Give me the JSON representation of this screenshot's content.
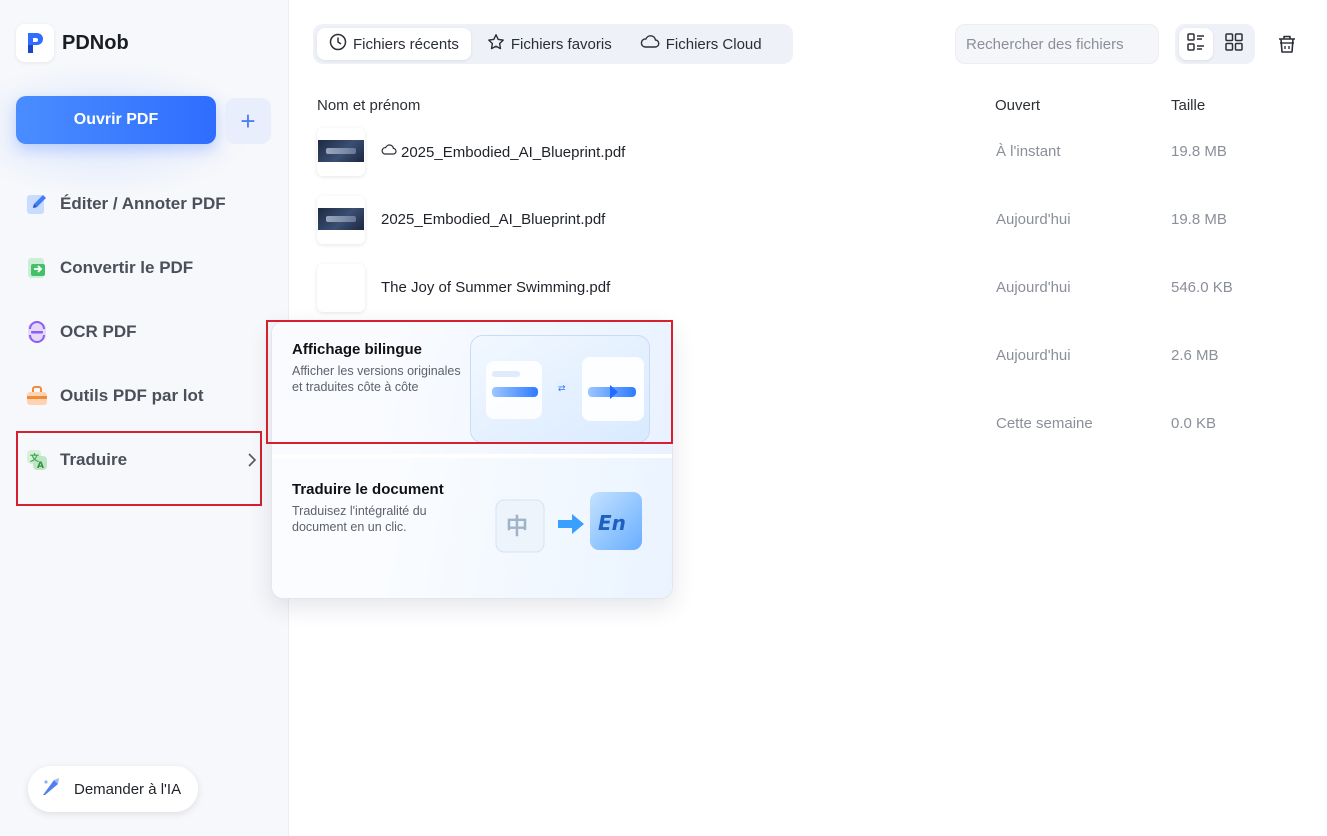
{
  "app": {
    "name": "PDNob"
  },
  "sidebar": {
    "open_button": "Ouvrir PDF",
    "add_button": "+",
    "items": [
      {
        "label": "Éditer / Annoter PDF",
        "icon": "edit-icon"
      },
      {
        "label": "Convertir le PDF",
        "icon": "convert-icon"
      },
      {
        "label": "OCR PDF",
        "icon": "ocr-icon"
      },
      {
        "label": "Outils PDF par lot",
        "icon": "batch-tools-icon"
      },
      {
        "label": "Traduire",
        "icon": "translate-icon"
      }
    ],
    "ask_ai": "Demander à l'IA"
  },
  "tabs": [
    {
      "label": "Fichiers récents",
      "icon": "clock-icon",
      "active": true
    },
    {
      "label": "Fichiers favoris",
      "icon": "star-icon",
      "active": false
    },
    {
      "label": "Fichiers Cloud",
      "icon": "cloud-icon",
      "active": false
    }
  ],
  "search": {
    "placeholder": "Rechercher des fichiers"
  },
  "columns": {
    "name": "Nom et prénom",
    "opened": "Ouvert",
    "size": "Taille"
  },
  "files": [
    {
      "name": "2025_Embodied_AI_Blueprint.pdf",
      "opened": "À l'instant",
      "size": "19.8 MB",
      "cloud": true
    },
    {
      "name": "2025_Embodied_AI_Blueprint.pdf",
      "opened": "Aujourd'hui",
      "size": "19.8 MB",
      "cloud": false
    },
    {
      "name": "The Joy of Summer Swimming.pdf",
      "opened": "Aujourd'hui",
      "size": "546.0 KB",
      "cloud": false
    },
    {
      "name": "",
      "opened": "Aujourd'hui",
      "size": "2.6 MB",
      "cloud": false
    },
    {
      "name": "",
      "opened": "Cette semaine",
      "size": "0.0 KB",
      "cloud": false
    }
  ],
  "translate_menu": {
    "bilingual": {
      "title": "Affichage bilingue",
      "desc": "Afficher les versions originales et traduites côte à côte"
    },
    "document": {
      "title": "Traduire le document",
      "desc": "Traduisez l'intégralité du document en un clic."
    }
  },
  "colors": {
    "accent": "#2f6dff",
    "highlight": "#d42030"
  }
}
